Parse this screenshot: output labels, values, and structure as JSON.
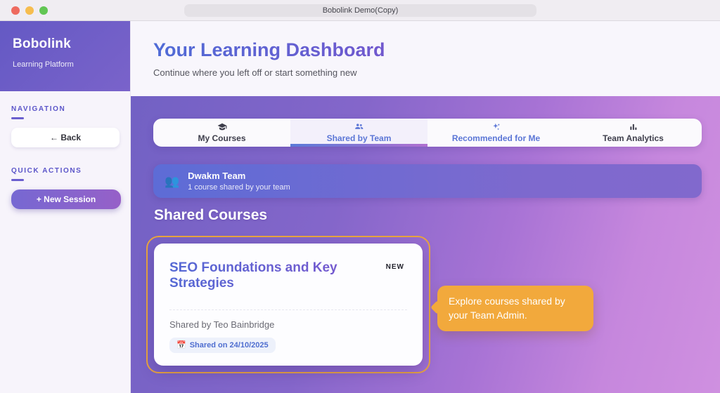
{
  "window": {
    "title": "Bobolink Demo(Copy)"
  },
  "sidebar": {
    "brand": {
      "name": "Bobolink",
      "tagline": "Learning Platform"
    },
    "navigation_label": "NAVIGATION",
    "back_label": "← Back",
    "quick_actions_label": "QUICK ACTIONS",
    "new_session_label": "+ New Session"
  },
  "header": {
    "title": "Your Learning Dashboard",
    "subtitle": "Continue where you left off or start something new"
  },
  "tabbar": {
    "tabs": [
      {
        "label": "My Courses",
        "icon": "graduation-cap-icon",
        "active": false
      },
      {
        "label": "Shared by Team",
        "icon": "people-icon",
        "active": true
      },
      {
        "label": "Recommended for Me",
        "icon": "sparkles-icon",
        "active": false
      },
      {
        "label": "Team Analytics",
        "icon": "bar-chart-icon",
        "active": false
      }
    ]
  },
  "team_banner": {
    "icon_glyph": "👥",
    "title": "Dwakm Team",
    "subtitle": "1 course shared by your team"
  },
  "shared_courses": {
    "heading": "Shared Courses",
    "card": {
      "title": "SEO Foundations and Key Strategies",
      "badge": "NEW",
      "shared_by": "Shared by Teo Bainbridge",
      "date_icon": "📅",
      "date_text": "Shared on 24/10/2025"
    }
  },
  "tooltip": {
    "text": "Explore courses shared by your Team Admin."
  },
  "colors": {
    "highlight_outline": "#e9a43e",
    "tooltip_bg": "#f2a93c",
    "accent_purple": "#6a5ec9",
    "active_tab_blue": "#5b76d6"
  }
}
